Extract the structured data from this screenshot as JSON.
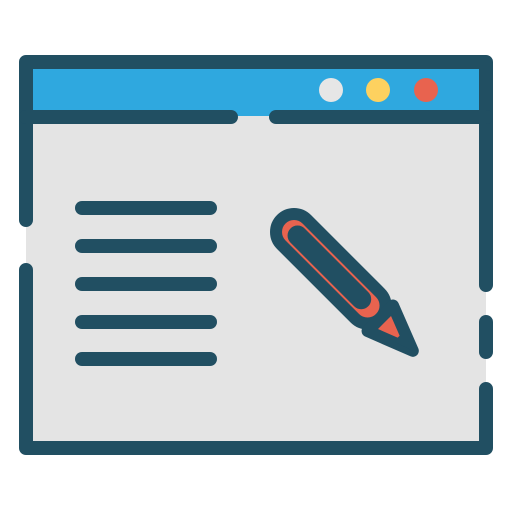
{
  "icon": {
    "name": "browser-window-edit-icon",
    "elements": {
      "window": "browser-window",
      "titlebar": "window-titlebar",
      "buttons": [
        "window-button-white",
        "window-button-yellow",
        "window-button-red"
      ],
      "content_lines": 5,
      "pencil": "pencil-icon"
    }
  },
  "colors": {
    "outline": "#214F62",
    "titlebar": "#2FA8DF",
    "content_bg": "#E4E4E4",
    "button_white": "#E6E6E6",
    "button_yellow": "#FDD15F",
    "button_red": "#E8634F",
    "pencil_body": "#E8634F",
    "pencil_tip": "#E8634F"
  }
}
